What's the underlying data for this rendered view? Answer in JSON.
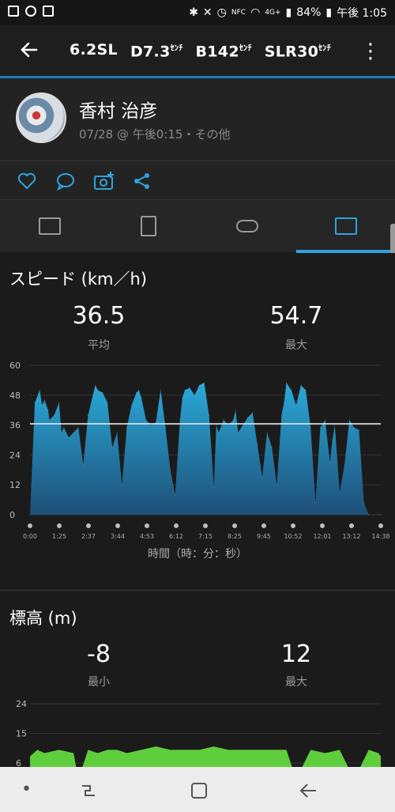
{
  "status": {
    "battery": "84%",
    "time": "午後 1:05",
    "network": "4G+"
  },
  "header": {
    "titles": [
      {
        "main": "6.2SL",
        "sup": ""
      },
      {
        "main": "D7.3",
        "sup": "ｾﾝﾁ"
      },
      {
        "main": "B142",
        "sup": "ｾﾝﾁ"
      },
      {
        "main": "SLR30",
        "sup": "ｾﾝﾁ"
      }
    ]
  },
  "profile": {
    "name": "香村 治彦",
    "subtitle": "07/28 @ 午後0:15・その他"
  },
  "speed": {
    "title": "スピード (km／h)",
    "avg_value": "36.5",
    "avg_label": "平均",
    "max_value": "54.7",
    "max_label": "最大",
    "x_axis_label": "時間（時：分：秒）"
  },
  "altitude": {
    "title": "標高 (m)",
    "min_value": "-8",
    "min_label": "最小",
    "max_value": "12",
    "max_label": "最大"
  },
  "colors": {
    "accent": "#2ea3dd",
    "speed_fill_top": "#2aa9d8",
    "speed_fill_bottom": "#1e4f78",
    "alt_fill": "#5fce3c"
  },
  "chart_data": [
    {
      "type": "area",
      "title": "",
      "xlabel": "時間（時：分：秒）",
      "ylabel": "",
      "ylim": [
        0,
        60
      ],
      "yticks": [
        0,
        12,
        24,
        36,
        48,
        60
      ],
      "x_tick_labels": [
        "0:00",
        "1:25",
        "2:37",
        "3:44",
        "4:53",
        "6:12",
        "7:15",
        "8:25",
        "9:45",
        "10:52",
        "12:01",
        "13:12",
        "14:38"
      ],
      "average_line": 36.5,
      "x": [
        0,
        0.2,
        0.4,
        0.5,
        0.6,
        0.75,
        0.8,
        1.0,
        1.2,
        1.3,
        1.4,
        1.6,
        1.8,
        2.0,
        2.2,
        2.4,
        2.6,
        2.7,
        2.8,
        3.0,
        3.2,
        3.4,
        3.6,
        3.8,
        4.0,
        4.2,
        4.4,
        4.5,
        4.6,
        4.8,
        5.0,
        5.2,
        5.4,
        5.6,
        5.8,
        6.0,
        6.2,
        6.3,
        6.4,
        6.6,
        6.8,
        7.0,
        7.2,
        7.4,
        7.6,
        7.7,
        7.8,
        8.0,
        8.2,
        8.4,
        8.5,
        8.6,
        8.8,
        9.0,
        9.2,
        9.4,
        9.6,
        9.8,
        10.0,
        10.2,
        10.4,
        10.5,
        10.6,
        10.8,
        11.0,
        11.2,
        11.4,
        11.6,
        11.8,
        12.0,
        12.2,
        12.4,
        12.5,
        12.6,
        12.8,
        13.0,
        13.2,
        13.4,
        13.6,
        13.8,
        14.0,
        14.2,
        14.4,
        14.5
      ],
      "values": [
        0,
        45,
        50,
        44,
        46,
        42,
        38,
        40,
        45,
        33,
        35,
        31,
        33,
        35,
        20,
        40,
        48,
        52,
        50,
        49,
        45,
        27,
        33,
        12,
        35,
        44,
        49,
        50,
        47,
        38,
        36,
        37,
        50,
        35,
        18,
        8,
        38,
        47,
        50,
        51,
        48,
        52,
        53,
        40,
        11,
        36,
        33,
        38,
        36,
        38,
        42,
        33,
        36,
        39,
        41,
        28,
        15,
        33,
        27,
        12,
        40,
        45,
        53,
        50,
        44,
        52,
        50,
        35,
        5,
        35,
        38,
        21,
        30,
        36,
        9,
        20,
        38,
        35,
        34,
        5,
        0,
        0,
        0,
        0
      ]
    },
    {
      "type": "area",
      "title": "",
      "ylim": [
        -8,
        24
      ],
      "yticks": [
        6,
        15,
        24
      ],
      "x": [
        0,
        0.3,
        0.6,
        1.2,
        1.8,
        2.0,
        2.4,
        2.8,
        3.2,
        3.6,
        4.0,
        4.6,
        5.2,
        5.8,
        6.4,
        7.0,
        7.6,
        8.2,
        8.8,
        9.4,
        10.0,
        10.6,
        11.0,
        11.6,
        12.2,
        12.8,
        13.4,
        14.0,
        14.4,
        14.5
      ],
      "values": [
        8,
        10,
        9,
        10,
        9,
        1,
        10,
        9,
        10,
        10,
        9,
        10,
        11,
        10,
        10,
        10,
        11,
        10,
        10,
        10,
        10,
        10,
        1,
        10,
        9,
        10,
        1,
        10,
        9,
        8
      ]
    }
  ]
}
